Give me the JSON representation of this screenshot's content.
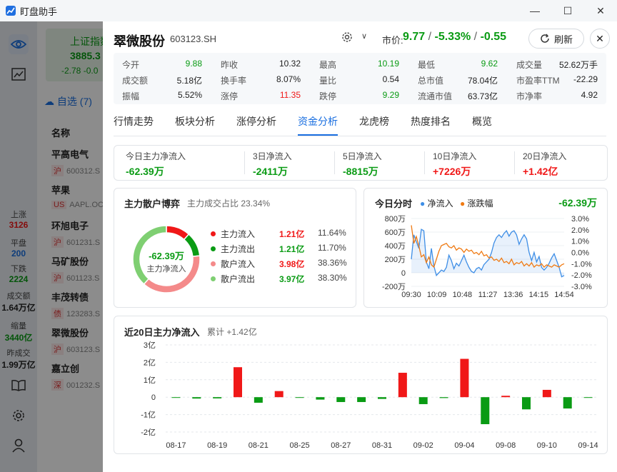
{
  "app": {
    "title": "盯盘助手"
  },
  "window_controls": {
    "minimize": "—",
    "maximize": "☐",
    "close": "✕"
  },
  "background": {
    "index_card": {
      "name": "上证指数",
      "value": "3885.3",
      "change": "-2.78",
      "pct": "-0.0"
    },
    "watchlist_tab": "自选 (7)",
    "column_header": "名称",
    "stocks": [
      {
        "name": "平高电气",
        "market": "沪",
        "code": "600312.S"
      },
      {
        "name": "苹果",
        "market": "US",
        "code": "AAPL.OC"
      },
      {
        "name": "环旭电子",
        "market": "沪",
        "code": "601231.S"
      },
      {
        "name": "马矿股份",
        "market": "沪",
        "code": "601123.S"
      },
      {
        "name": "丰茂转债",
        "market": "债",
        "code": "123283.S"
      },
      {
        "name": "翠微股份",
        "market": "沪",
        "code": "603123.S"
      },
      {
        "name": "嘉立创",
        "market": "深",
        "code": "001232.S"
      }
    ],
    "market_stats": [
      {
        "label": "上涨",
        "value": "3126",
        "color": "#f01818"
      },
      {
        "label": "平盘",
        "value": "200",
        "color": "#1a6fe0"
      },
      {
        "label": "下跌",
        "value": "2224",
        "color": "#0a9b14"
      },
      {
        "label": "成交额",
        "value": "1.64万亿",
        "color": "#222222"
      },
      {
        "label": "缩量",
        "value": "3440亿",
        "color": "#0a9b14"
      },
      {
        "label": "昨成交",
        "value": "1.99万亿",
        "color": "#222222"
      }
    ]
  },
  "stock": {
    "name": "翠微股份",
    "code": "603123.SH",
    "price_label": "市价:",
    "price": "9.77",
    "change_pct": "-5.33%",
    "change": "-0.55",
    "slash": "/",
    "refresh_label": "刷新",
    "close_symbol": "✕",
    "settings_caret": "∨"
  },
  "quote": [
    [
      {
        "label": "今开",
        "value": "9.88",
        "color": "#0a9b14"
      },
      {
        "label": "昨收",
        "value": "10.32",
        "color": "#222222"
      },
      {
        "label": "最高",
        "value": "10.19",
        "color": "#0a9b14"
      },
      {
        "label": "最低",
        "value": "9.62",
        "color": "#0a9b14"
      },
      {
        "label": "成交量",
        "value": "52.62万手",
        "color": "#222222"
      }
    ],
    [
      {
        "label": "成交额",
        "value": "5.18亿",
        "color": "#222222"
      },
      {
        "label": "换手率",
        "value": "8.07%",
        "color": "#222222"
      },
      {
        "label": "量比",
        "value": "0.54",
        "color": "#222222"
      },
      {
        "label": "总市值",
        "value": "78.04亿",
        "color": "#222222"
      },
      {
        "label": "市盈率TTM",
        "value": "-22.29",
        "color": "#222222"
      }
    ],
    [
      {
        "label": "振幅",
        "value": "5.52%",
        "color": "#222222"
      },
      {
        "label": "涨停",
        "value": "11.35",
        "color": "#f01818"
      },
      {
        "label": "跌停",
        "value": "9.29",
        "color": "#0a9b14"
      },
      {
        "label": "流通市值",
        "value": "63.73亿",
        "color": "#222222"
      },
      {
        "label": "市净率",
        "value": "4.92",
        "color": "#222222"
      }
    ]
  ],
  "tabs": [
    "行情走势",
    "板块分析",
    "涨停分析",
    "资金分析",
    "龙虎榜",
    "热度排名",
    "概览"
  ],
  "active_tab": 3,
  "net_flows": [
    {
      "label": "今日主力净流入",
      "value": "-62.39万",
      "color": "#0a9b14"
    },
    {
      "label": "3日净流入",
      "value": "-2411万",
      "color": "#0a9b14"
    },
    {
      "label": "5日净流入",
      "value": "-8815万",
      "color": "#0a9b14"
    },
    {
      "label": "10日净流入",
      "value": "+7226万",
      "color": "#f01818"
    },
    {
      "label": "20日净流入",
      "value": "+1.42亿",
      "color": "#f01818"
    }
  ],
  "battle": {
    "title": "主力散户博弈",
    "subtitle": "主力成交占比 23.34%",
    "center_value": "-62.39万",
    "center_label": "主力净流入",
    "items": [
      {
        "label": "主力流入",
        "amount": "1.21亿",
        "pct": "11.64%",
        "dot": "#f01818",
        "amount_color": "#f01818",
        "share": 11.64
      },
      {
        "label": "主力流出",
        "amount": "1.21亿",
        "pct": "11.70%",
        "dot": "#0a9b14",
        "amount_color": "#0a9b14",
        "share": 11.7
      },
      {
        "label": "散户流入",
        "amount": "3.98亿",
        "pct": "38.36%",
        "dot": "#f48a8a",
        "amount_color": "#f01818",
        "share": 38.36
      },
      {
        "label": "散户流出",
        "amount": "3.97亿",
        "pct": "38.30%",
        "dot": "#7fcf72",
        "amount_color": "#0a9b14",
        "share": 38.3
      }
    ]
  },
  "chart_data": [
    {
      "type": "line",
      "title": "今日分时",
      "headline": "-62.39万",
      "x_ticks": [
        "09:30",
        "10:09",
        "10:48",
        "11:27",
        "13:36",
        "14:15",
        "14:54"
      ],
      "y_left_ticks": [
        "800万",
        "600万",
        "400万",
        "200万",
        "0",
        "-200万"
      ],
      "y_left_lim": [
        -200,
        800
      ],
      "y_right_ticks": [
        "3.0%",
        "2.0%",
        "1.0%",
        "0.0%",
        "-1.0%",
        "-2.0%",
        "-3.0%"
      ],
      "y_right_lim": [
        -3,
        3
      ],
      "series": [
        {
          "name": "净流入",
          "axis": "left",
          "color": "#3e8ee6",
          "values": [
            200,
            560,
            460,
            360,
            640,
            620,
            160,
            60,
            360,
            100,
            -40,
            0,
            40,
            20,
            80,
            260,
            180,
            60,
            140,
            100,
            180,
            260,
            160,
            80,
            20,
            0,
            60,
            80,
            40,
            120,
            160,
            200,
            300,
            440,
            520,
            560,
            520,
            580,
            620,
            540,
            600,
            620,
            560,
            420,
            500,
            560,
            500,
            300,
            180,
            300,
            160,
            240,
            80,
            40,
            80,
            140,
            220,
            280,
            180,
            80,
            -60,
            -40
          ]
        },
        {
          "name": "涨跌幅",
          "axis": "right",
          "color": "#f07a12",
          "values": [
            2.4,
            0.8,
            1.4,
            0.6,
            -0.4,
            -0.2,
            -0.9,
            -0.4,
            -1.1,
            -1.3,
            -0.6,
            0.1,
            0.6,
            0.7,
            0.8,
            0.5,
            0.4,
            0.6,
            0.2,
            0.4,
            0.3,
            0.0,
            0.3,
            0.1,
            0.2,
            -0.1,
            0.0,
            -0.2,
            0.1,
            -0.3,
            -0.2,
            -0.5,
            -0.4,
            -0.7,
            -0.6,
            -0.8,
            -0.5,
            -0.9,
            -0.8,
            -1.0,
            -0.6,
            -1.1,
            -0.9,
            -1.0,
            -0.8,
            -1.2,
            -1.0,
            -1.2,
            -0.9,
            -1.3,
            -1.1,
            -1.2,
            -1.0,
            -1.3,
            -1.1,
            -1.2,
            -1.3,
            -1.1,
            -1.2,
            -1.3,
            -1.1,
            -1.0
          ]
        }
      ]
    },
    {
      "type": "bar",
      "title": "近20日主力净流入",
      "subtitle": "累计 +1.42亿",
      "ylabel_ticks": [
        "3亿",
        "2亿",
        "1亿",
        "0",
        "-1亿",
        "-2亿"
      ],
      "ylim": [
        -2,
        3
      ],
      "x_ticks": [
        "08-17",
        "08-19",
        "08-21",
        "08-25",
        "08-27",
        "08-31",
        "09-02",
        "09-04",
        "09-08",
        "09-10",
        "09-14"
      ],
      "values": [
        -0.03,
        -0.08,
        -0.07,
        1.72,
        -0.32,
        0.35,
        -0.03,
        -0.14,
        -0.28,
        -0.28,
        -0.1,
        1.4,
        -0.4,
        -0.05,
        2.2,
        -1.55,
        0.08,
        -0.7,
        0.42,
        -0.65,
        -0.01
      ],
      "up_color": "#f01818",
      "down_color": "#0a9b14"
    }
  ]
}
